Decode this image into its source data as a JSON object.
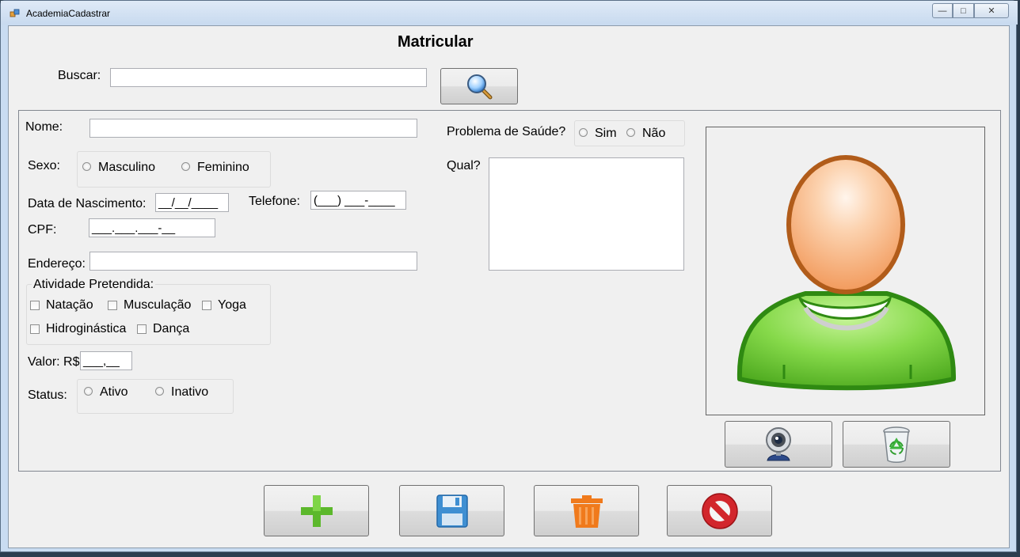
{
  "window": {
    "title": "AcademiaCadastrar",
    "controls": {
      "minimize": "—",
      "maximize": "□",
      "close": "✕"
    }
  },
  "form": {
    "heading": "Matricular",
    "search": {
      "label": "Buscar:",
      "value": "",
      "icon": "magnifier-icon"
    },
    "nome": {
      "label": "Nome:",
      "value": ""
    },
    "sexo": {
      "label": "Sexo:",
      "options": [
        "Masculino",
        "Feminino"
      ]
    },
    "nascimento": {
      "label": "Data de Nascimento:",
      "mask": "__/__/____"
    },
    "telefone": {
      "label": "Telefone:",
      "mask": "(___) ___-____"
    },
    "cpf": {
      "label": "CPF:",
      "mask": "___.___.___-__"
    },
    "endereco": {
      "label": "Endereço:",
      "value": ""
    },
    "atividade": {
      "legend": "Atividade Pretendida:",
      "options": [
        "Natação",
        "Musculação",
        "Yoga",
        "Hidroginástica",
        "Dança"
      ]
    },
    "valor": {
      "label": "Valor: R$",
      "mask": "___,__"
    },
    "status": {
      "label": "Status:",
      "options": [
        "Ativo",
        "Inativo"
      ]
    },
    "saude": {
      "label": "Problema de Saúde?",
      "options": [
        "Sim",
        "Não"
      ]
    },
    "qual": {
      "label": "Qual?",
      "value": ""
    }
  },
  "photo_buttons": [
    {
      "name": "webcam-button",
      "icon": "webcam-icon"
    },
    {
      "name": "clear-photo-button",
      "icon": "recycle-bin-icon"
    }
  ],
  "actions": [
    {
      "name": "add-button",
      "icon": "plus-icon"
    },
    {
      "name": "save-button",
      "icon": "floppy-disk-icon"
    },
    {
      "name": "delete-button",
      "icon": "trash-icon"
    },
    {
      "name": "cancel-button",
      "icon": "cancel-icon"
    }
  ],
  "colors": {
    "plus": "#5cb82c",
    "floppy": "#3f8fd2",
    "trash": "#f07a1c",
    "cancel": "#d2262c",
    "avatar_head": "#f7b98a",
    "avatar_body": "#78d13e"
  }
}
